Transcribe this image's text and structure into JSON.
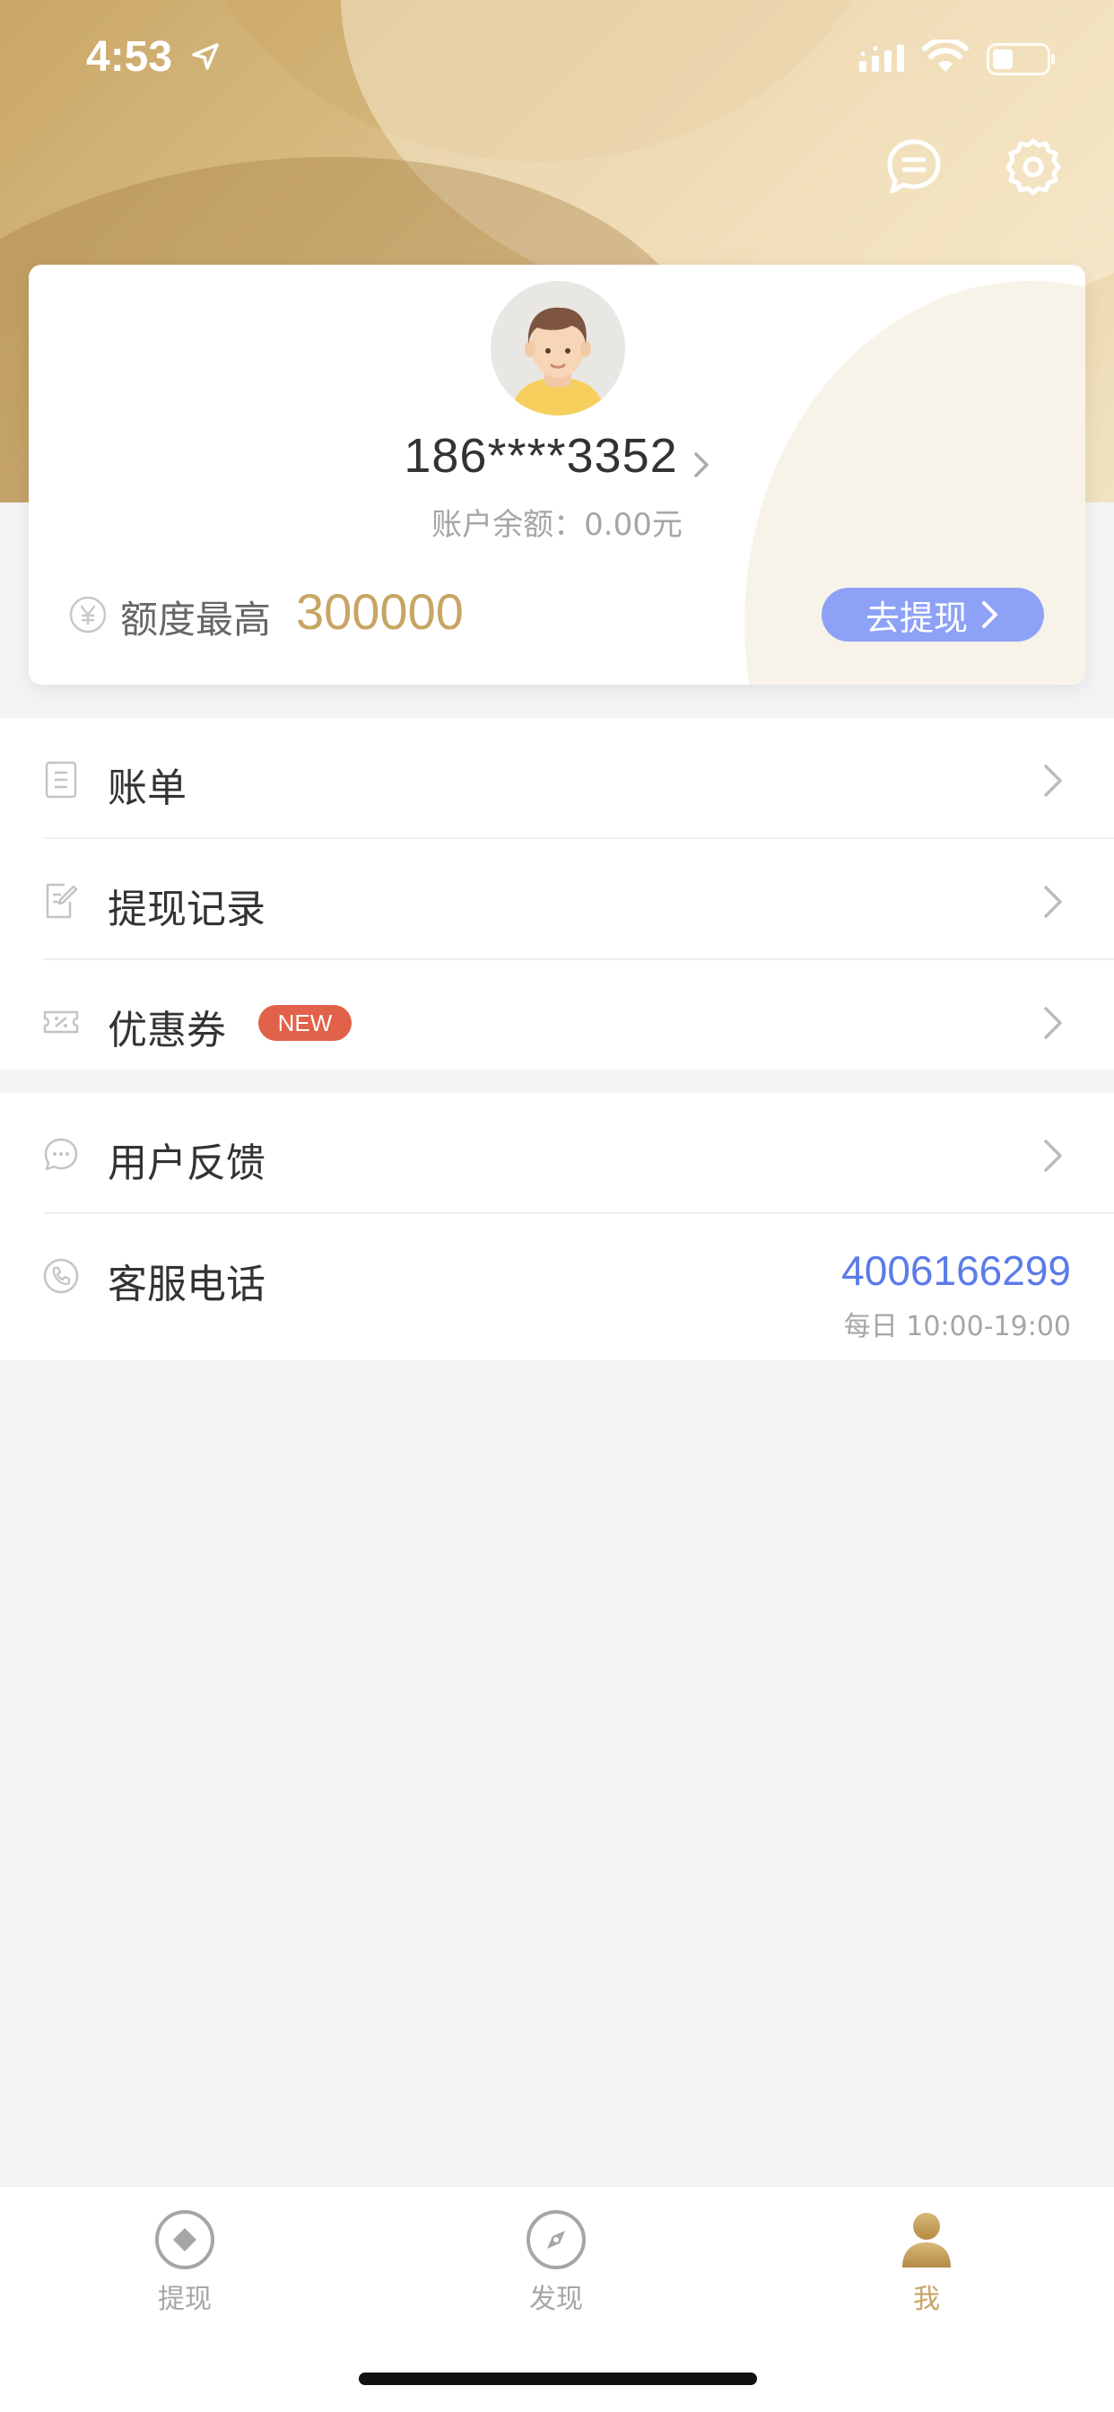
{
  "status_bar": {
    "time": "4:53"
  },
  "card": {
    "phone": "186****3352",
    "balance": "账户余额：0.00元",
    "quota_label": "额度最高",
    "quota_value": "300000",
    "withdraw_label": "去提现"
  },
  "menu": {
    "bill": "账单",
    "withdraw_records": "提现记录",
    "coupons": "优惠券",
    "coupons_badge": "NEW",
    "feedback": "用户反馈",
    "hotline": "客服电话",
    "hotline_number": "4006166299",
    "hotline_hours": "每日 10:00-19:00"
  },
  "tabs": [
    {
      "label": "提现",
      "icon": "diamond-icon"
    },
    {
      "label": "发现",
      "icon": "compass-icon"
    },
    {
      "label": "我",
      "icon": "user-icon",
      "active": true
    }
  ],
  "colors": {
    "gold": "#c7a563",
    "button_blue": "#8da2f7",
    "link_blue": "#5b7be8",
    "badge_red": "#e2614a"
  }
}
